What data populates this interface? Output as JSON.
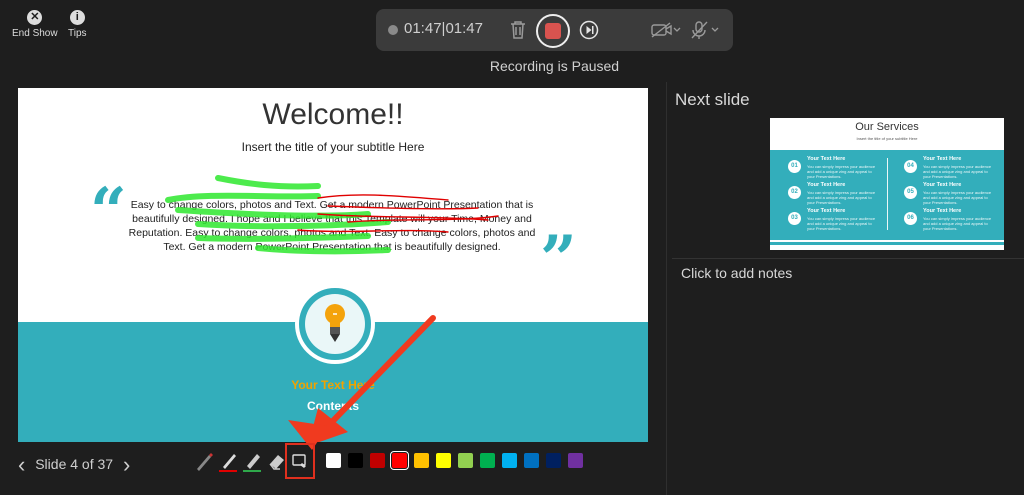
{
  "topbar": {
    "end_show_label": "End Show",
    "tips_label": "Tips"
  },
  "recording": {
    "time_elapsed": "01:47",
    "time_separator": "|",
    "time_total": "01:47",
    "status": "Recording is Paused"
  },
  "slide": {
    "title": "Welcome!!",
    "subtitle": "Insert the title of your subtitle Here",
    "body": "Easy to change colors, photos and Text. Get a modern PowerPoint Presentation that is beautifully designed. I hope and I believe that this Template will your Time, Money and Reputation. Easy to change colors, photos and Text. Easy to change colors, photos and Text. Get a modern PowerPoint Presentation that is beautifully designed.",
    "open_quote": "“",
    "close_quote": "”",
    "your_text": "Your Text  Here",
    "contents": "Contents",
    "accent_color": "#33aebb"
  },
  "navigation": {
    "prev_icon": "‹",
    "label": "Slide 4 of 37",
    "next_icon": "›"
  },
  "pen_colors": [
    "#ffffff",
    "#000000",
    "#c00000",
    "#ff0000",
    "#ffc000",
    "#ffff00",
    "#92d050",
    "#00b050",
    "#00b0f0",
    "#0070c0",
    "#002060",
    "#7030a0"
  ],
  "next_slide": {
    "heading": "Next slide",
    "thumb_title": "Our Services",
    "thumb_subtitle": "Insert the title of your subtitle Here",
    "items": [
      {
        "num": "01",
        "title": "Your Text  Here",
        "desc": "You can simply impress your audience and add a unique zing and appeal to your Presentations."
      },
      {
        "num": "02",
        "title": "Your Text  Here",
        "desc": "You can simply impress your audience and add a unique zing and appeal to your Presentations."
      },
      {
        "num": "03",
        "title": "Your Text  Here",
        "desc": "You can simply impress your audience and add a unique zing and appeal to your Presentations."
      },
      {
        "num": "04",
        "title": "Your Text  Here",
        "desc": "You can simply impress your audience and add a unique zing and appeal to your Presentations."
      },
      {
        "num": "05",
        "title": "Your Text  Here",
        "desc": "You can simply impress your audience and add a unique zing and appeal to your Presentations."
      },
      {
        "num": "06",
        "title": "Your Text  Here",
        "desc": "You can simply impress your audience and add a unique zing and appeal to your Presentations."
      }
    ]
  },
  "notes": {
    "placeholder": "Click to add notes"
  },
  "annotation": {
    "highlight_color": "#2ee82e",
    "pen_color": "#e00000",
    "arrow_color": "#f03a1f"
  }
}
